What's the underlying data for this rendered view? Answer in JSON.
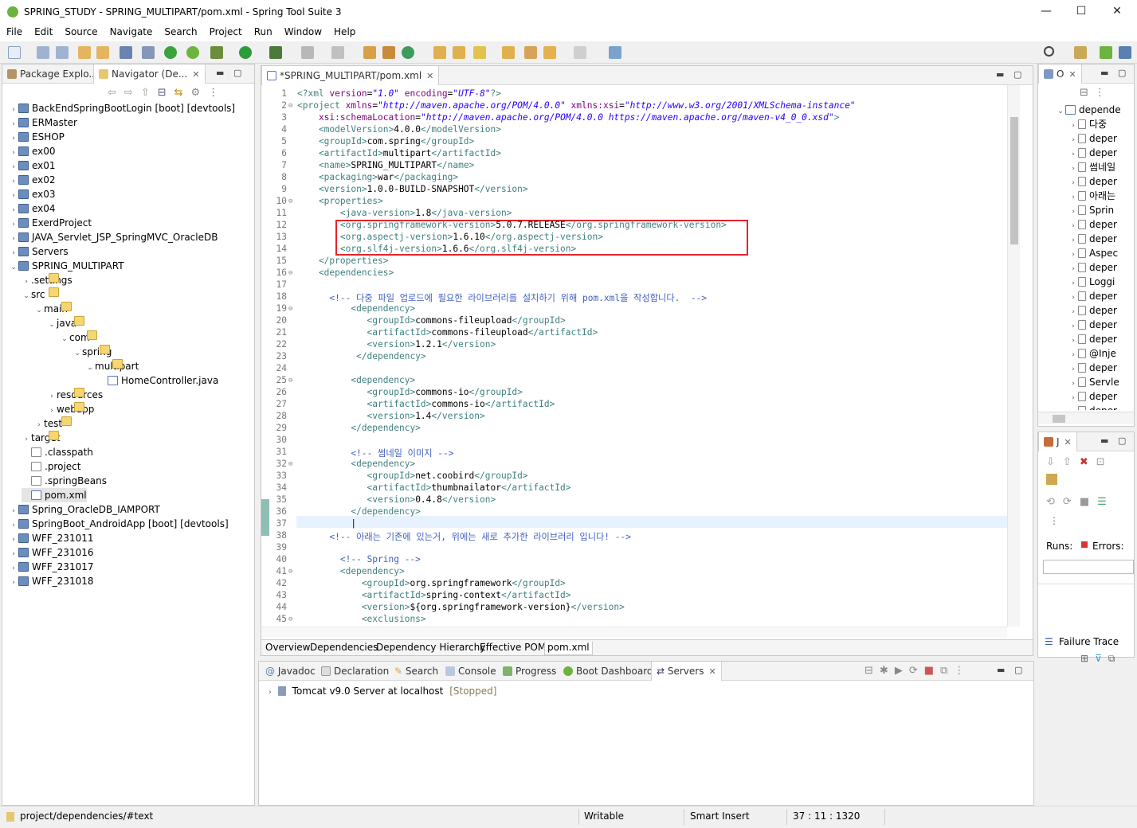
{
  "window": {
    "title": "SPRING_STUDY - SPRING_MULTIPART/pom.xml - Spring Tool Suite 3",
    "minimize": "—",
    "maximize": "☐",
    "close": "✕"
  },
  "menu": [
    "File",
    "Edit",
    "Source",
    "Navigate",
    "Search",
    "Project",
    "Run",
    "Window",
    "Help"
  ],
  "left_panel": {
    "tabs": [
      {
        "label": "Package Explo..."
      },
      {
        "label": "Navigator (De..."
      }
    ],
    "tree": [
      {
        "label": "BackEndSpringBootLogin [boot] [devtools]",
        "level": 0,
        "icon": "project",
        "twisty": "collapsed"
      },
      {
        "label": "ERMaster",
        "level": 0,
        "icon": "project",
        "twisty": "collapsed"
      },
      {
        "label": "ESHOP",
        "level": 0,
        "icon": "project",
        "twisty": "collapsed"
      },
      {
        "label": "ex00",
        "level": 0,
        "icon": "project",
        "twisty": "collapsed"
      },
      {
        "label": "ex01",
        "level": 0,
        "icon": "project",
        "twisty": "collapsed"
      },
      {
        "label": "ex02",
        "level": 0,
        "icon": "project",
        "twisty": "collapsed"
      },
      {
        "label": "ex03",
        "level": 0,
        "icon": "project",
        "twisty": "collapsed"
      },
      {
        "label": "ex04",
        "level": 0,
        "icon": "project",
        "twisty": "collapsed"
      },
      {
        "label": "ExerdProject",
        "level": 0,
        "icon": "project",
        "twisty": "collapsed"
      },
      {
        "label": "JAVA_Servlet_JSP_SpringMVC_OracleDB",
        "level": 0,
        "icon": "project",
        "twisty": "collapsed"
      },
      {
        "label": "Servers",
        "level": 0,
        "icon": "project",
        "twisty": "collapsed"
      },
      {
        "label": "SPRING_MULTIPART",
        "level": 0,
        "icon": "project",
        "twisty": "expanded"
      },
      {
        "label": ".settings",
        "level": 1,
        "icon": "folder",
        "twisty": "collapsed"
      },
      {
        "label": "src",
        "level": 1,
        "icon": "folder",
        "twisty": "expanded"
      },
      {
        "label": "main",
        "level": 2,
        "icon": "folder",
        "twisty": "expanded"
      },
      {
        "label": "java",
        "level": 3,
        "icon": "folder",
        "twisty": "expanded"
      },
      {
        "label": "com",
        "level": 4,
        "icon": "folder",
        "twisty": "expanded"
      },
      {
        "label": "spring",
        "level": 5,
        "icon": "folder",
        "twisty": "expanded"
      },
      {
        "label": "multipart",
        "level": 6,
        "icon": "folder",
        "twisty": "expanded"
      },
      {
        "label": "HomeController.java",
        "level": 7,
        "icon": "java",
        "twisty": "none"
      },
      {
        "label": "resources",
        "level": 3,
        "icon": "folder",
        "twisty": "collapsed"
      },
      {
        "label": "webapp",
        "level": 3,
        "icon": "folder",
        "twisty": "collapsed"
      },
      {
        "label": "test",
        "level": 2,
        "icon": "folder",
        "twisty": "collapsed"
      },
      {
        "label": "target",
        "level": 1,
        "icon": "folder",
        "twisty": "collapsed"
      },
      {
        "label": ".classpath",
        "level": 1,
        "icon": "file",
        "twisty": "none"
      },
      {
        "label": ".project",
        "level": 1,
        "icon": "file",
        "twisty": "none"
      },
      {
        "label": ".springBeans",
        "level": 1,
        "icon": "file",
        "twisty": "none"
      },
      {
        "label": "pom.xml",
        "level": 1,
        "icon": "pom",
        "twisty": "none",
        "selected": true
      },
      {
        "label": "Spring_OracleDB_IAMPORT",
        "level": 0,
        "icon": "project",
        "twisty": "collapsed"
      },
      {
        "label": "SpringBoot_AndroidApp [boot] [devtools]",
        "level": 0,
        "icon": "project",
        "twisty": "collapsed"
      },
      {
        "label": "WFF_231011",
        "level": 0,
        "icon": "project",
        "twisty": "collapsed"
      },
      {
        "label": "WFF_231016",
        "level": 0,
        "icon": "project",
        "twisty": "collapsed"
      },
      {
        "label": "WFF_231017",
        "level": 0,
        "icon": "project",
        "twisty": "collapsed"
      },
      {
        "label": "WFF_231018",
        "level": 0,
        "icon": "project",
        "twisty": "collapsed"
      }
    ]
  },
  "editor": {
    "tab_label": "*SPRING_MULTIPART/pom.xml",
    "lines": [
      {
        "n": "1",
        "segs": [
          [
            "t",
            "<?xml "
          ],
          [
            "an",
            "version"
          ],
          [
            "",
            "="
          ],
          [
            "av",
            "\"1.0\""
          ],
          [
            "an",
            " encoding"
          ],
          [
            "",
            "="
          ],
          [
            "av",
            "\"UTF-8\""
          ],
          [
            "t",
            "?>"
          ]
        ]
      },
      {
        "n": "2",
        "fold": true,
        "segs": [
          [
            "t",
            "<project "
          ],
          [
            "an",
            "xmlns"
          ],
          [
            "",
            "="
          ],
          [
            "av",
            "\"http://maven.apache.org/POM/4.0.0\""
          ],
          [
            "an",
            " xmlns:xsi"
          ],
          [
            "",
            "="
          ],
          [
            "av",
            "\"http://www.w3.org/2001/XMLSchema-instance\""
          ]
        ]
      },
      {
        "n": "3",
        "segs": [
          [
            "",
            "    "
          ],
          [
            "an",
            "xsi:schemaLocation"
          ],
          [
            "",
            "="
          ],
          [
            "av",
            "\"http://maven.apache.org/POM/4.0.0 https://maven.apache.org/maven-v4_0_0.xsd\""
          ],
          [
            "t",
            ">"
          ]
        ]
      },
      {
        "n": "4",
        "segs": [
          [
            "t",
            "    <modelVersion>"
          ],
          [
            "",
            "4.0.0"
          ],
          [
            "t",
            "</modelVersion>"
          ]
        ]
      },
      {
        "n": "5",
        "segs": [
          [
            "t",
            "    <groupId>"
          ],
          [
            "",
            "com.spring"
          ],
          [
            "t",
            "</groupId>"
          ]
        ]
      },
      {
        "n": "6",
        "segs": [
          [
            "t",
            "    <artifactId>"
          ],
          [
            "",
            "multipart"
          ],
          [
            "t",
            "</artifactId>"
          ]
        ]
      },
      {
        "n": "7",
        "segs": [
          [
            "t",
            "    <name>"
          ],
          [
            "",
            "SPRING_MULTIPART"
          ],
          [
            "t",
            "</name>"
          ]
        ]
      },
      {
        "n": "8",
        "segs": [
          [
            "t",
            "    <packaging>"
          ],
          [
            "",
            "war"
          ],
          [
            "t",
            "</packaging>"
          ]
        ]
      },
      {
        "n": "9",
        "segs": [
          [
            "t",
            "    <version>"
          ],
          [
            "",
            "1.0.0-BUILD-SNAPSHOT"
          ],
          [
            "t",
            "</version>"
          ]
        ]
      },
      {
        "n": "10",
        "fold": true,
        "segs": [
          [
            "t",
            "    <properties>"
          ]
        ]
      },
      {
        "n": "11",
        "segs": [
          [
            "t",
            "        <java-version>"
          ],
          [
            "",
            "1.8"
          ],
          [
            "t",
            "</java-version>"
          ]
        ]
      },
      {
        "n": "12",
        "segs": [
          [
            "t",
            "        <org.springframework-version>"
          ],
          [
            "",
            "5.0.7.RELEASE"
          ],
          [
            "t",
            "</org.springframework-version>"
          ]
        ]
      },
      {
        "n": "13",
        "segs": [
          [
            "t",
            "        <org.aspectj-version>"
          ],
          [
            "",
            "1.6.10"
          ],
          [
            "t",
            "</org.aspectj-version>"
          ]
        ]
      },
      {
        "n": "14",
        "segs": [
          [
            "t",
            "        <org.slf4j-version>"
          ],
          [
            "",
            "1.6.6"
          ],
          [
            "t",
            "</org.slf4j-version>"
          ]
        ]
      },
      {
        "n": "15",
        "segs": [
          [
            "t",
            "    </properties>"
          ]
        ]
      },
      {
        "n": "16",
        "fold": true,
        "segs": [
          [
            "t",
            "    <dependencies>"
          ]
        ]
      },
      {
        "n": "17",
        "segs": []
      },
      {
        "n": "18",
        "segs": [
          [
            "",
            "      "
          ],
          [
            "cm",
            "<!-- 다중 파일 업로드에 필요한 라이브러리를 설치하기 위해 pom.xml을 작성합니다.  -->"
          ]
        ]
      },
      {
        "n": "19",
        "fold": true,
        "segs": [
          [
            "t",
            "          <dependency>"
          ]
        ]
      },
      {
        "n": "20",
        "segs": [
          [
            "t",
            "             <groupId>"
          ],
          [
            "",
            "commons-fileupload"
          ],
          [
            "t",
            "</groupId>"
          ]
        ]
      },
      {
        "n": "21",
        "segs": [
          [
            "t",
            "             <artifactId>"
          ],
          [
            "",
            "commons-fileupload"
          ],
          [
            "t",
            "</artifactId>"
          ]
        ]
      },
      {
        "n": "22",
        "segs": [
          [
            "t",
            "             <version>"
          ],
          [
            "",
            "1.2.1"
          ],
          [
            "t",
            "</version>"
          ]
        ]
      },
      {
        "n": "23",
        "segs": [
          [
            "t",
            "           </dependency>"
          ]
        ]
      },
      {
        "n": "24",
        "segs": []
      },
      {
        "n": "25",
        "fold": true,
        "segs": [
          [
            "t",
            "          <dependency>"
          ]
        ]
      },
      {
        "n": "26",
        "segs": [
          [
            "t",
            "             <groupId>"
          ],
          [
            "",
            "commons-io"
          ],
          [
            "t",
            "</groupId>"
          ]
        ]
      },
      {
        "n": "27",
        "segs": [
          [
            "t",
            "             <artifactId>"
          ],
          [
            "",
            "commons-io"
          ],
          [
            "t",
            "</artifactId>"
          ]
        ]
      },
      {
        "n": "28",
        "segs": [
          [
            "t",
            "             <version>"
          ],
          [
            "",
            "1.4"
          ],
          [
            "t",
            "</version>"
          ]
        ]
      },
      {
        "n": "29",
        "segs": [
          [
            "t",
            "          </dependency>"
          ]
        ]
      },
      {
        "n": "30",
        "segs": []
      },
      {
        "n": "31",
        "segs": [
          [
            "",
            "          "
          ],
          [
            "cm",
            "<!-- 썸네일 이미지 -->"
          ]
        ]
      },
      {
        "n": "32",
        "fold": true,
        "segs": [
          [
            "t",
            "          <dependency>"
          ]
        ]
      },
      {
        "n": "33",
        "segs": [
          [
            "t",
            "             <groupId>"
          ],
          [
            "",
            "net.coobird"
          ],
          [
            "t",
            "</groupId>"
          ]
        ]
      },
      {
        "n": "34",
        "segs": [
          [
            "t",
            "             <artifactId>"
          ],
          [
            "",
            "thumbnailator"
          ],
          [
            "t",
            "</artifactId>"
          ]
        ]
      },
      {
        "n": "35",
        "segs": [
          [
            "t",
            "             <version>"
          ],
          [
            "",
            "0.4.8"
          ],
          [
            "t",
            "</version>"
          ]
        ]
      },
      {
        "n": "36",
        "segs": [
          [
            "t",
            "          </dependency>"
          ]
        ]
      },
      {
        "n": "37",
        "current": true,
        "segs": [
          [
            "",
            "          |"
          ]
        ]
      },
      {
        "n": "38",
        "segs": [
          [
            "",
            "      "
          ],
          [
            "cm",
            "<!-- 아래는 기존에 있는거, 위에는 새로 추가한 라이브러리 입니다! -->"
          ]
        ]
      },
      {
        "n": "39",
        "segs": []
      },
      {
        "n": "40",
        "segs": [
          [
            "",
            "        "
          ],
          [
            "cm",
            "<!-- Spring -->"
          ]
        ]
      },
      {
        "n": "41",
        "fold": true,
        "segs": [
          [
            "t",
            "        <dependency>"
          ]
        ]
      },
      {
        "n": "42",
        "segs": [
          [
            "t",
            "            <groupId>"
          ],
          [
            "",
            "org.springframework"
          ],
          [
            "t",
            "</groupId>"
          ]
        ]
      },
      {
        "n": "43",
        "segs": [
          [
            "t",
            "            <artifactId>"
          ],
          [
            "",
            "spring-context"
          ],
          [
            "t",
            "</artifactId>"
          ]
        ]
      },
      {
        "n": "44",
        "segs": [
          [
            "t",
            "            <version>"
          ],
          [
            "",
            "${org.springframework-version}"
          ],
          [
            "t",
            "</version>"
          ]
        ]
      },
      {
        "n": "45",
        "fold": true,
        "segs": [
          [
            "t",
            "            <exclusions>"
          ]
        ]
      }
    ],
    "bottom_tabs": [
      "Overview",
      "Dependencies",
      "Dependency Hierarchy",
      "Effective POM",
      "pom.xml"
    ]
  },
  "outline": {
    "tab": "O",
    "root": "depende",
    "items": [
      "다중",
      "deper",
      "deper",
      "썸네일",
      "deper",
      "아래는",
      "Sprin",
      "deper",
      "deper",
      "Aspec",
      "deper",
      "Loggi",
      "deper",
      "deper",
      "deper",
      "deper",
      "@Inje",
      "deper",
      "Servle",
      "deper",
      "deper"
    ]
  },
  "junit": {
    "tab": "J",
    "runs_label": "Runs:",
    "errors_label": "Errors:",
    "failure_trace": "Failure Trace"
  },
  "bottom_panel": {
    "tabs": [
      "Javadoc",
      "Declaration",
      "Search",
      "Console",
      "Progress",
      "Boot Dashboard",
      "Servers"
    ],
    "server": {
      "name": "Tomcat v9.0 Server at localhost",
      "status": "[Stopped]"
    }
  },
  "status": {
    "path": "project/dependencies/#text",
    "writable": "Writable",
    "insert": "Smart Insert",
    "position": "37 : 11 : 1320"
  }
}
